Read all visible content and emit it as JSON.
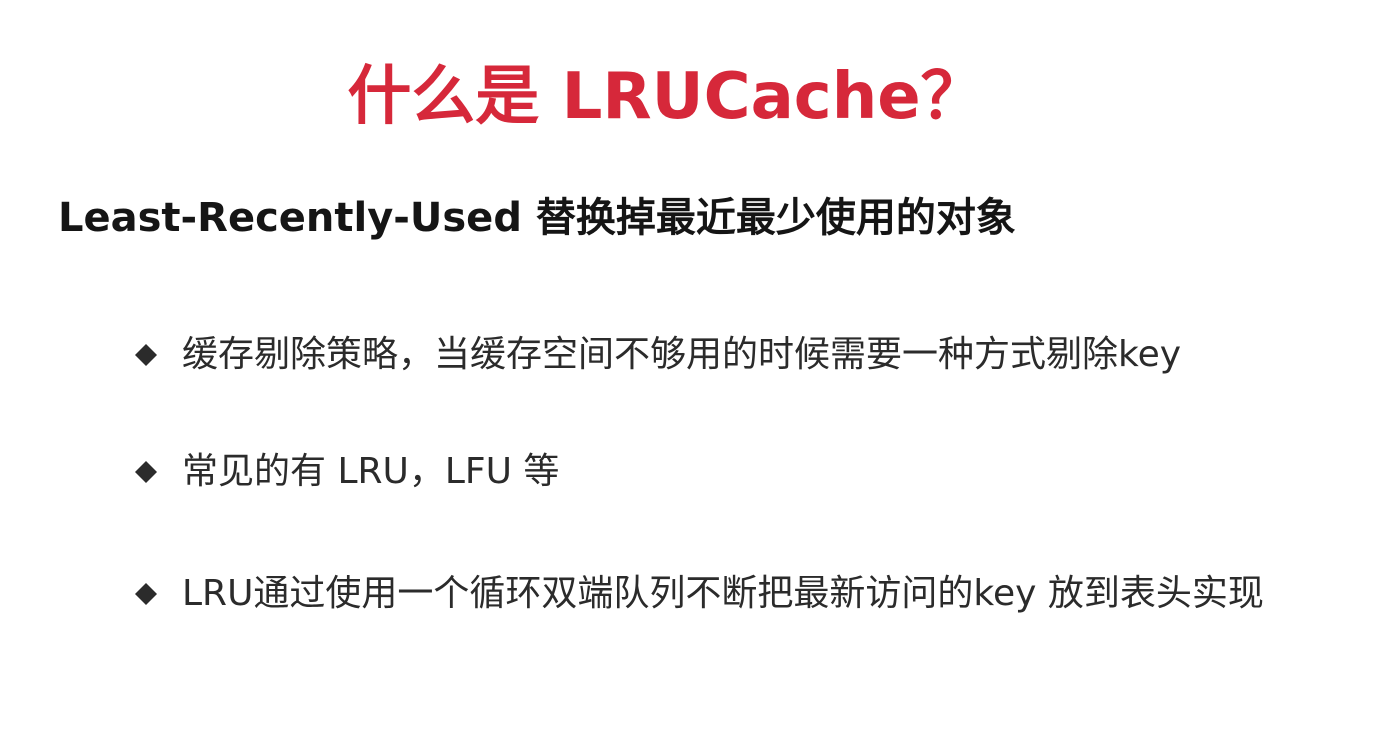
{
  "slide": {
    "title": "什么是 LRUCache？",
    "subtitle": "Least-Recently-Used 替换掉最近最少使用的对象",
    "bullets": [
      {
        "icon": "diamond-bullet-icon",
        "text": "缓存剔除策略，当缓存空间不够用的时候需要一种方式剔除key"
      },
      {
        "icon": "diamond-bullet-icon",
        "text": "常见的有 LRU，LFU 等"
      },
      {
        "icon": "diamond-bullet-icon",
        "text": "LRU通过使用一个循环双端队列不断把最新访问的key 放到表头实现"
      }
    ]
  },
  "colors": {
    "title": "#d6283a",
    "subtitle": "#151515",
    "bullet_text": "#2b2b2b",
    "bullet_icon": "#2b2b2b"
  }
}
